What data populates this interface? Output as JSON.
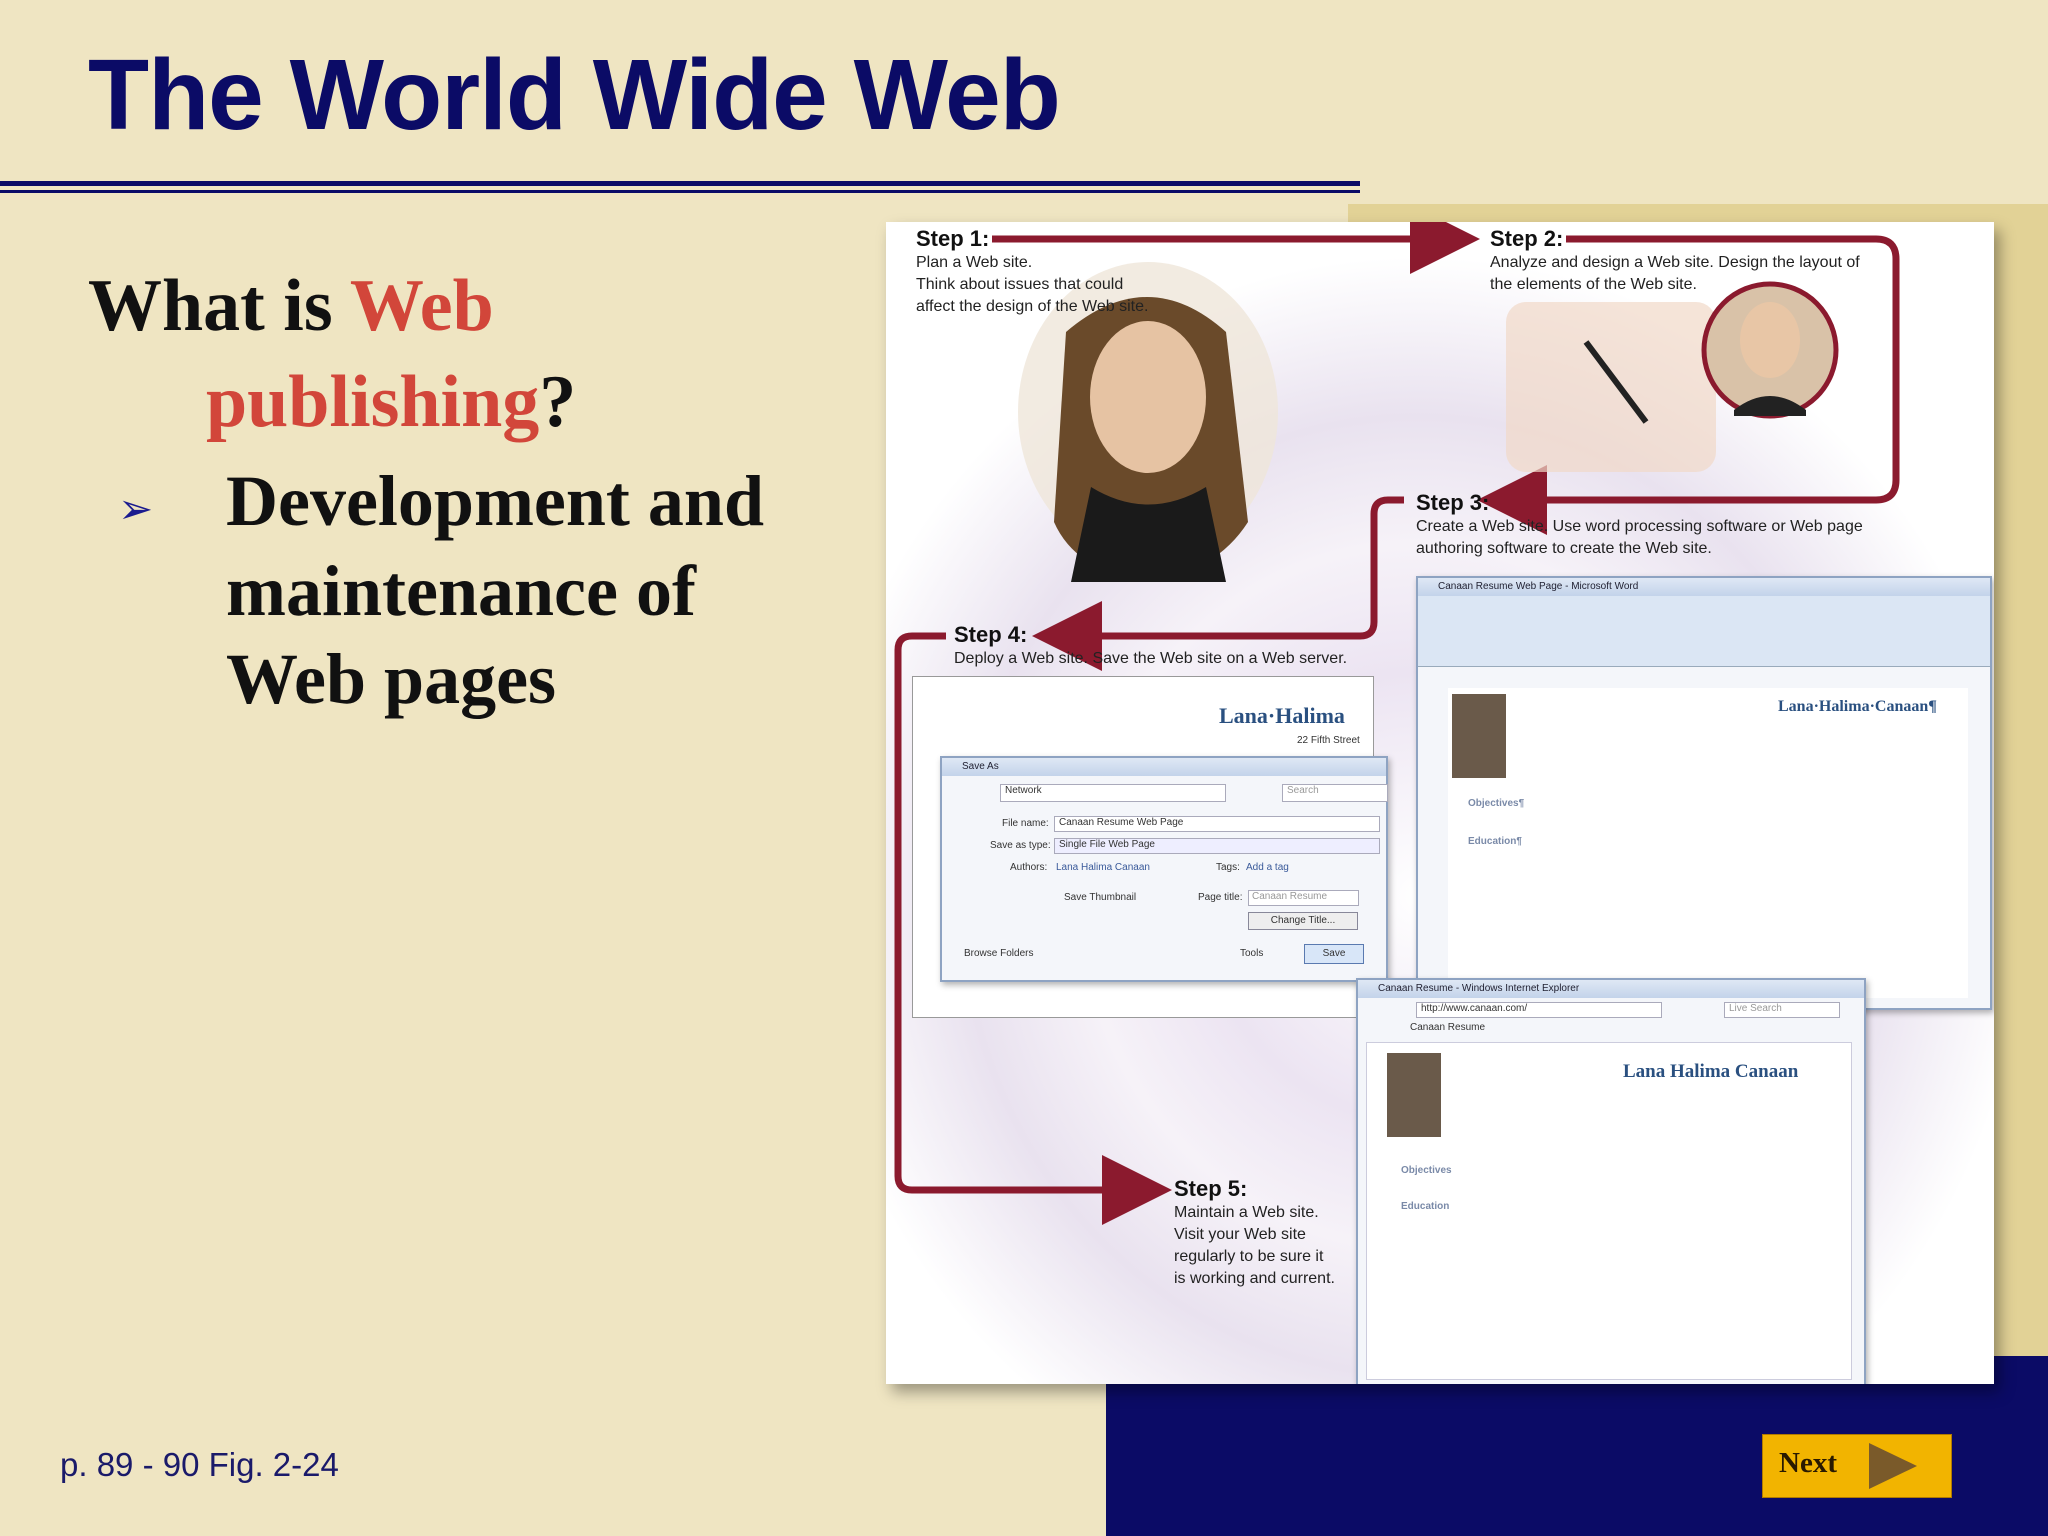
{
  "slide": {
    "title": "The World Wide Web",
    "question_part1": "What is ",
    "question_highlight1": "Web",
    "question_highlight2": "publishing",
    "question_end": "?",
    "bullet_symbol": "➢",
    "bullet_lines": [
      "Development and",
      "maintenance of",
      "Web pages"
    ],
    "reference": "p. 89 - 90 Fig. 2-24",
    "next_label": "Next"
  },
  "figure": {
    "steps": [
      {
        "heading": "Step 1:",
        "lines": [
          "Plan a Web site.",
          "Think about issues that could",
          "affect the design of the Web site."
        ]
      },
      {
        "heading": "Step 2:",
        "lines": [
          "Analyze and design a Web site. Design the layout of",
          "the elements of the Web site."
        ]
      },
      {
        "heading": "Step 3:",
        "lines": [
          "Create a Web site. Use word processing software or Web page",
          "authoring software to create the Web site."
        ]
      },
      {
        "heading": "Step 4:",
        "lines": [
          "Deploy a Web site. Save the Web site on a Web server."
        ]
      },
      {
        "heading": "Step 5:",
        "lines": [
          "Maintain a Web site.",
          "Visit your Web site",
          "regularly to be sure it",
          "is working and current."
        ]
      }
    ],
    "word_window": {
      "title": "Canaan Resume Web Page - Microsoft Word",
      "name": "Lana·Halima·Canaan¶",
      "section1": "Objectives¶",
      "section2": "Education¶"
    },
    "save_dialog": {
      "title": "Save As",
      "location": "Network",
      "search_placeholder": "Search",
      "file_name_label": "File name:",
      "file_name": "Canaan Resume Web Page",
      "type_label": "Save as type:",
      "type_value": "Single File Web Page",
      "authors_label": "Authors:",
      "authors_value": "Lana Halima Canaan",
      "tags_label": "Tags:",
      "tags_value": "Add a tag",
      "page_title_label": "Page title:",
      "page_title_value": "Canaan Resume",
      "thumbnail_label": "Save Thumbnail",
      "change_title": "Change Title...",
      "browse": "Browse Folders",
      "tools": "Tools",
      "save": "Save",
      "behind_name": "Lana·Halima",
      "behind_address": "22 Fifth Street"
    },
    "browser_window": {
      "title": "Canaan Resume - Windows Internet Explorer",
      "url": "http://www.canaan.com/",
      "tab": "Canaan Resume",
      "search_placeholder": "Live Search",
      "name": "Lana Halima Canaan",
      "section1": "Objectives",
      "section2": "Education"
    }
  },
  "colors": {
    "background": "#efe5c2",
    "title": "#0b0b66",
    "highlight": "#d2463a",
    "arrow": "#8b1a2e",
    "next_button": "#f2b400"
  }
}
